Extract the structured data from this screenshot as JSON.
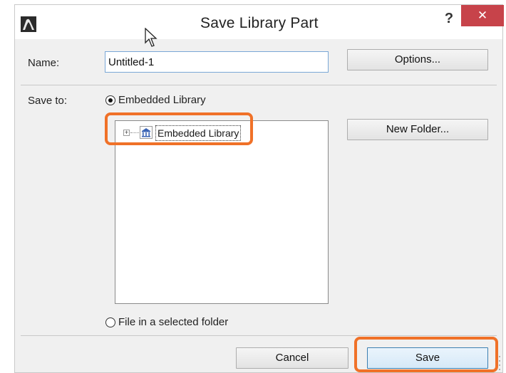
{
  "window": {
    "title": "Save Library Part",
    "help_glyph": "?",
    "close_glyph": "✕",
    "app_icon": "archicad-app-icon"
  },
  "name_row": {
    "label": "Name:",
    "value": "Untitled-1"
  },
  "options_button": "Options...",
  "save_to": {
    "label": "Save to:",
    "embedded_option": "Embedded Library",
    "embedded_selected": true,
    "folder_option": "File in a selected folder",
    "folder_selected": false
  },
  "tree": {
    "items": [
      {
        "label": "Embedded Library",
        "expander": "+",
        "icon": "library-icon"
      }
    ]
  },
  "new_folder_button": "New Folder...",
  "footer": {
    "cancel": "Cancel",
    "save": "Save"
  },
  "colors": {
    "highlight": "#f07128",
    "close_button": "#c7434a",
    "dialog_bg": "#f0f0f0"
  }
}
